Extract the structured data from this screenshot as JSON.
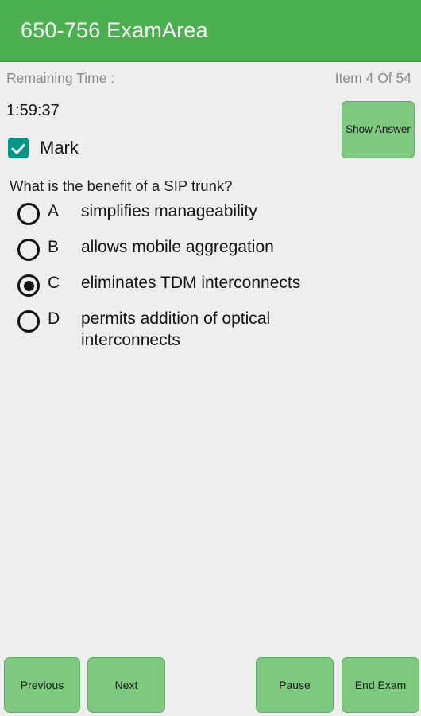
{
  "appbar": {
    "title": "650-756 ExamArea",
    "background_color": "#4CAF50",
    "text_color": "#FFFFFF"
  },
  "meta": {
    "remaining_time_label": "Remaining Time :",
    "item_progress": "Item 4 Of 54"
  },
  "timer": {
    "value": "1:59:37"
  },
  "show_answer": {
    "label": "Show Answer"
  },
  "mark": {
    "label": "Mark",
    "checked": true,
    "color": "#009688"
  },
  "question": {
    "text": "What is the benefit of a SIP trunk?"
  },
  "options": [
    {
      "letter": "A",
      "text": "simplifies manageability",
      "selected": false
    },
    {
      "letter": "B",
      "text": "allows mobile aggregation",
      "selected": false
    },
    {
      "letter": "C",
      "text": "eliminates TDM interconnects",
      "selected": true
    },
    {
      "letter": "D",
      "text": "permits addition of optical interconnects",
      "selected": false
    }
  ],
  "bottom_bar": {
    "previous_label": "Previous",
    "next_label": "Next",
    "pause_label": "Pause",
    "end_exam_label": "End Exam",
    "button_color": "#7DC97F",
    "button_border_color": "#5FAE63"
  }
}
